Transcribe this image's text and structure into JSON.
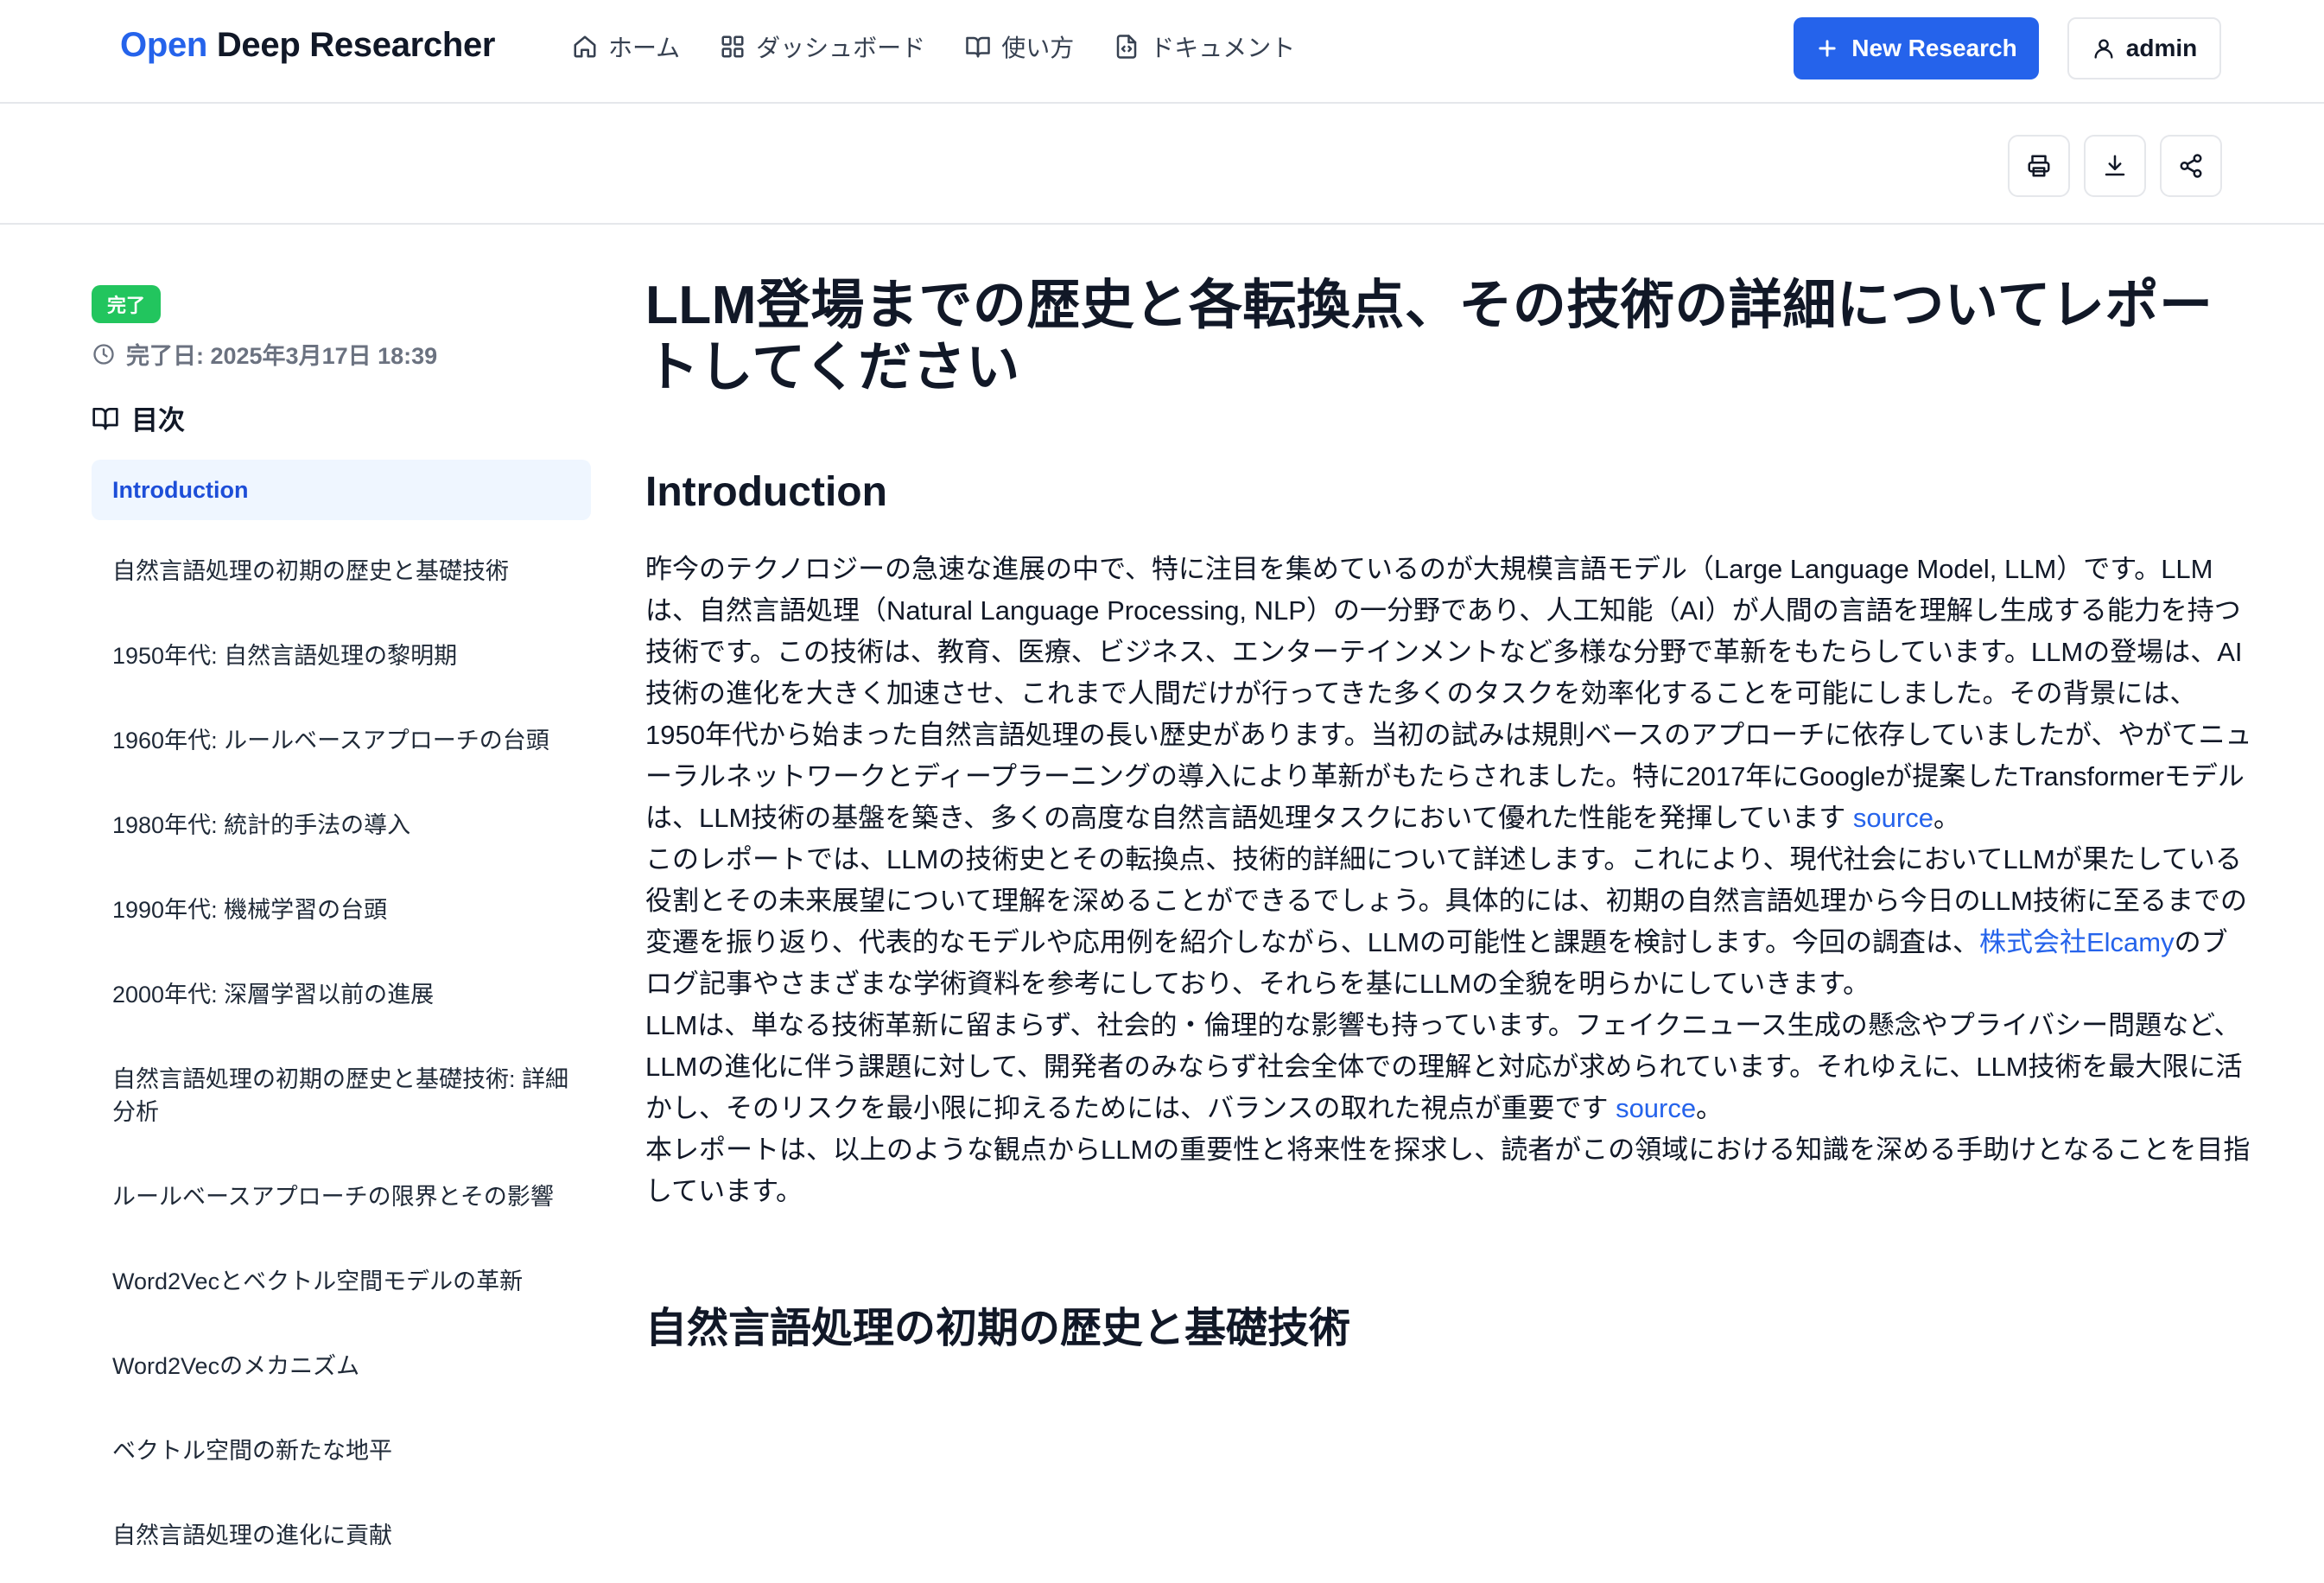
{
  "header": {
    "brand_open": "Open",
    "brand_rest": " Deep Researcher",
    "nav": [
      {
        "label": "ホーム",
        "icon": "home-icon"
      },
      {
        "label": "ダッシュボード",
        "icon": "grid-icon"
      },
      {
        "label": "使い方",
        "icon": "book-open-icon"
      },
      {
        "label": "ドキュメント",
        "icon": "file-code-icon"
      }
    ],
    "new_research_label": "New Research",
    "user_label": "admin"
  },
  "toolbar": {
    "actions": [
      "print-icon",
      "download-icon",
      "share-icon"
    ]
  },
  "sidebar": {
    "status_badge": "完了",
    "completed_date": "完了日: 2025年3月17日 18:39",
    "toc_title": "目次",
    "toc_items": [
      "Introduction",
      "自然言語処理の初期の歴史と基礎技術",
      "1950年代: 自然言語処理の黎明期",
      "1960年代: ルールベースアプローチの台頭",
      "1980年代: 統計的手法の導入",
      "1990年代: 機械学習の台頭",
      "2000年代: 深層学習以前の進展",
      "自然言語処理の初期の歴史と基礎技術: 詳細分析",
      "ルールベースアプローチの限界とその影響",
      "Word2Vecとベクトル空間モデルの革新",
      "Word2Vecのメカニズム",
      "ベクトル空間の新たな地平",
      "自然言語処理の進化に貢献"
    ]
  },
  "main": {
    "title": "LLM登場までの歴史と各転換点、その技術の詳細についてレポートしてください",
    "intro_heading": "Introduction",
    "p1_text": "昨今のテクノロジーの急速な進展の中で、特に注目を集めているのが大規模言語モデル（Large Language Model, LLM）です。LLMは、自然言語処理（Natural Language Processing, NLP）の一分野であり、人工知能（AI）が人間の言語を理解し生成する能力を持つ技術です。この技術は、教育、医療、ビジネス、エンターテインメントなど多様な分野で革新をもたらしています。LLMの登場は、AI技術の進化を大きく加速させ、これまで人間だけが行ってきた多くのタスクを効率化することを可能にしました。その背景には、1950年代から始まった自然言語処理の長い歴史があります。当初の試みは規則ベースのアプローチに依存していましたが、やがてニューラルネットワークとディープラーニングの導入により革新がもたらされました。特に2017年にGoogleが提案したTransformerモデルは、LLM技術の基盤を築き、多くの高度な自然言語処理タスクにおいて優れた性能を発揮しています ",
    "p1_link": "source",
    "p1_end": "。",
    "p2_text": "このレポートでは、LLMの技術史とその転換点、技術的詳細について詳述します。これにより、現代社会においてLLMが果たしている役割とその未来展望について理解を深めることができるでしょう。具体的には、初期の自然言語処理から今日のLLM技術に至るまでの変遷を振り返り、代表的なモデルや応用例を紹介しながら、LLMの可能性と課題を検討します。今回の調査は、",
    "p2_link": "株式会社Elcamy",
    "p2_end": "のブログ記事やさまざまな学術資料を参考にしており、それらを基にLLMの全貌を明らかにしていきます。",
    "p3_text": "LLMは、単なる技術革新に留まらず、社会的・倫理的な影響も持っています。フェイクニュース生成の懸念やプライバシー問題など、LLMの進化に伴う課題に対して、開発者のみならず社会全体での理解と対応が求められています。それゆえに、LLM技術を最大限に活かし、そのリスクを最小限に抑えるためには、バランスの取れた視点が重要です ",
    "p3_link": "source",
    "p3_end": "。",
    "p4_text": "本レポートは、以上のような観点からLLMの重要性と将来性を探求し、読者がこの領域における知識を深める手助けとなることを目指しています。",
    "section2_heading": "自然言語処理の初期の歴史と基礎技術"
  },
  "colors": {
    "accent": "#2563eb",
    "success": "#22c55e",
    "active_bg": "#eff6ff"
  }
}
